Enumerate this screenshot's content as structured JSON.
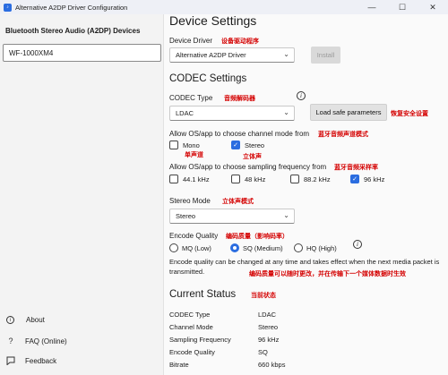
{
  "window": {
    "title": "Alternative A2DP Driver Configuration",
    "controls": {
      "minimize": "—",
      "maximize": "☐",
      "close": "✕"
    }
  },
  "sidebar": {
    "title": "Bluetooth Stereo Audio (A2DP) Devices",
    "device": "WF-1000XM4",
    "links": [
      {
        "label": "About"
      },
      {
        "label": "FAQ (Online)"
      },
      {
        "label": "Feedback"
      }
    ]
  },
  "settings": {
    "heading": "Device Settings",
    "device_driver": {
      "label": "Device Driver",
      "annotation": "设备驱动程序",
      "value": "Alternative A2DP Driver",
      "install_label": "Install"
    }
  },
  "codec": {
    "heading": "CODEC Settings",
    "codec_type": {
      "label": "CODEC Type",
      "annotation": "音频解码器",
      "value": "LDAC",
      "load_safe_label": "Load safe parameters",
      "load_safe_annotation": "恢复安全设置"
    },
    "channel_mode": {
      "label": "Allow OS/app to choose channel mode from",
      "annotation": "蓝牙音频声道模式",
      "options": [
        {
          "label": "Mono",
          "checked": false,
          "annotation": "单声道"
        },
        {
          "label": "Stereo",
          "checked": true,
          "annotation": "立体声"
        }
      ]
    },
    "sampling": {
      "label": "Allow OS/app to choose sampling frequency from",
      "annotation": "蓝牙音频采样率",
      "options": [
        {
          "label": "44.1 kHz",
          "checked": false
        },
        {
          "label": "48 kHz",
          "checked": false
        },
        {
          "label": "88.2 kHz",
          "checked": false
        },
        {
          "label": "96 kHz",
          "checked": true
        }
      ]
    },
    "stereo_mode": {
      "label": "Stereo Mode",
      "annotation": "立体声模式",
      "value": "Stereo"
    },
    "encode_quality": {
      "label": "Encode Quality",
      "annotation": "编码质量（影响码率）",
      "options": [
        {
          "label": "MQ (Low)",
          "selected": false
        },
        {
          "label": "SQ (Medium)",
          "selected": true
        },
        {
          "label": "HQ (High)",
          "selected": false
        }
      ],
      "note": "Encode quality can be changed at any time and takes effect when the next media packet is transmitted.",
      "note_annotation": "编码质量可以随时更改，并在传输下一个媒体数据时生效"
    }
  },
  "status": {
    "heading": "Current Status",
    "annotation": "当前状态",
    "rows": [
      {
        "key": "CODEC Type",
        "value": "LDAC"
      },
      {
        "key": "Channel Mode",
        "value": "Stereo"
      },
      {
        "key": "Sampling Frequency",
        "value": "96 kHz"
      },
      {
        "key": "Encode Quality",
        "value": "SQ"
      },
      {
        "key": "Bitrate",
        "value": "660 kbps"
      }
    ]
  },
  "colors": {
    "accent": "#2b6de0",
    "annotation": "#d40000"
  }
}
